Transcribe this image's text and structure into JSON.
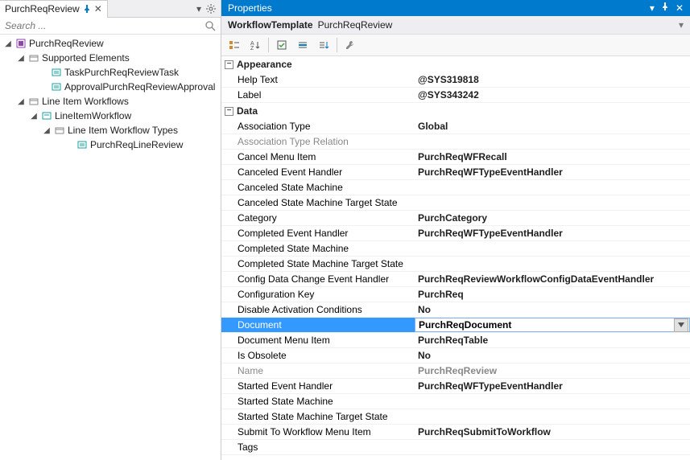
{
  "left": {
    "tab_title": "PurchReqReview",
    "search_placeholder": "Search ...",
    "tree": {
      "root": "PurchReqReview",
      "groups": [
        {
          "label": "Supported Elements",
          "children": [
            "TaskPurchReqReviewTask",
            "ApprovalPurchReqReviewApproval"
          ]
        },
        {
          "label": "Line Item Workflows",
          "children_nodes": [
            {
              "label": "LineItemWorkflow",
              "children_nodes": [
                {
                  "label": "Line Item Workflow Types",
                  "children": [
                    "PurchReqLineReview"
                  ]
                }
              ]
            }
          ]
        }
      ]
    }
  },
  "properties": {
    "panel_title": "Properties",
    "object_kind": "WorkflowTemplate",
    "object_name": "PurchReqReview",
    "categories": [
      {
        "name": "Appearance",
        "rows": [
          {
            "name": "Help Text",
            "value": "@SYS319818"
          },
          {
            "name": "Label",
            "value": "@SYS343242"
          }
        ]
      },
      {
        "name": "Data",
        "rows": [
          {
            "name": "Association Type",
            "value": "Global"
          },
          {
            "name": "Association Type Relation",
            "value": "",
            "disabledName": true
          },
          {
            "name": "Cancel Menu Item",
            "value": "PurchReqWFRecall"
          },
          {
            "name": "Canceled Event Handler",
            "value": "PurchReqWFTypeEventHandler"
          },
          {
            "name": "Canceled State Machine",
            "value": ""
          },
          {
            "name": "Canceled State Machine Target State",
            "value": ""
          },
          {
            "name": "Category",
            "value": "PurchCategory"
          },
          {
            "name": "Completed Event Handler",
            "value": "PurchReqWFTypeEventHandler"
          },
          {
            "name": "Completed State Machine",
            "value": ""
          },
          {
            "name": "Completed State Machine Target State",
            "value": ""
          },
          {
            "name": "Config Data Change Event Handler",
            "value": "PurchReqReviewWorkflowConfigDataEventHandler"
          },
          {
            "name": "Configuration Key",
            "value": "PurchReq"
          },
          {
            "name": "Disable Activation Conditions",
            "value": "No"
          },
          {
            "name": "Document",
            "value": "PurchReqDocument",
            "selected": true
          },
          {
            "name": "Document Menu Item",
            "value": "PurchReqTable"
          },
          {
            "name": "Is Obsolete",
            "value": "No"
          },
          {
            "name": "Name",
            "value": "PurchReqReview",
            "disabledName": true,
            "disabledValue": true
          },
          {
            "name": "Started Event Handler",
            "value": "PurchReqWFTypeEventHandler"
          },
          {
            "name": "Started State Machine",
            "value": ""
          },
          {
            "name": "Started State Machine Target State",
            "value": ""
          },
          {
            "name": "Submit To Workflow Menu Item",
            "value": "PurchReqSubmitToWorkflow"
          },
          {
            "name": "Tags",
            "value": ""
          }
        ]
      }
    ]
  }
}
